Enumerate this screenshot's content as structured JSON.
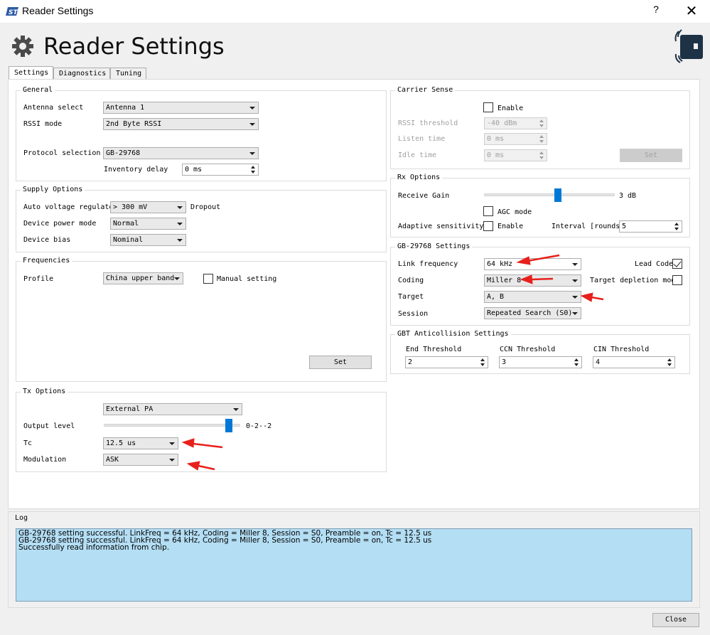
{
  "window": {
    "title": "Reader Settings",
    "help": "?",
    "close": "✕"
  },
  "header": {
    "title": "Reader Settings"
  },
  "tabs": [
    {
      "label": "Settings",
      "active": true
    },
    {
      "label": "Diagnostics",
      "active": false
    },
    {
      "label": "Tuning",
      "active": false
    }
  ],
  "general": {
    "title": "General",
    "antenna_label": "Antenna select",
    "antenna_value": "Antenna 1",
    "rssi_label": "RSSI mode",
    "rssi_value": "2nd Byte RSSI",
    "protocol_label": "Protocol selection",
    "protocol_value": "GB-29768",
    "inventory_delay_label": "Inventory delay",
    "inventory_delay_value": "0 ms"
  },
  "supply": {
    "title": "Supply Options",
    "avr_label": "Auto voltage regulator",
    "avr_value": "> 300 mV",
    "avr_suffix": "Dropout",
    "power_mode_label": "Device power mode",
    "power_mode_value": "Normal",
    "bias_label": "Device bias",
    "bias_value": "Nominal"
  },
  "frequencies": {
    "title": "Frequencies",
    "profile_label": "Profile",
    "profile_value": "China upper band",
    "manual_label": "Manual setting",
    "manual_checked": false,
    "set_label": "Set"
  },
  "tx": {
    "title": "Tx Options",
    "pa_value": "External PA",
    "output_label": "Output level",
    "output_value": "0-2--2",
    "output_fraction": 0.94,
    "tc_label": "Tc",
    "tc_value": "12.5 us",
    "modulation_label": "Modulation",
    "modulation_value": "ASK"
  },
  "carrier": {
    "title": "Carrier Sense",
    "enable_label": "Enable",
    "enable_checked": false,
    "rssi_threshold_label": "RSSI threshold",
    "rssi_threshold_value": "-40 dBm",
    "listen_label": "Listen time",
    "listen_value": "0 ms",
    "idle_label": "Idle time",
    "idle_value": "0 ms",
    "set_label": "Set"
  },
  "rx": {
    "title": "Rx Options",
    "gain_label": "Receive Gain",
    "gain_value": "3 dB",
    "gain_fraction": 0.57,
    "agc_label": "AGC mode",
    "agc_checked": false,
    "adaptive_label": "Adaptive sensitivity",
    "adaptive_enable_label": "Enable",
    "adaptive_checked": false,
    "interval_label": "Interval [rounds]",
    "interval_value": "5"
  },
  "gb": {
    "title": "GB-29768 Settings",
    "link_label": "Link frequency",
    "link_value": "64 kHz",
    "lead_label": "Lead Code",
    "lead_checked": true,
    "coding_label": "Coding",
    "coding_value": "Miller 8",
    "depletion_label": "Target depletion mode",
    "depletion_checked": false,
    "target_label": "Target",
    "target_value": "A, B",
    "session_label": "Session",
    "session_value": "Repeated Search (S0)"
  },
  "gbt": {
    "title": "GBT Anticollision Settings",
    "end_label": "End Threshold",
    "end_value": "2",
    "ccn_label": "CCN Threshold",
    "ccn_value": "3",
    "cin_label": "CIN Threshold",
    "cin_value": "4"
  },
  "log": {
    "title": "Log",
    "lines": [
      "GB-29768 setting successful. LinkFreq = 64 kHz, Coding = Miller 8, Session = S0, Preamble = on, Tc = 12.5 us",
      "GB-29768 setting successful. LinkFreq = 64 kHz, Coding = Miller 8, Session = S0, Preamble = on, Tc = 12.5 us",
      "Successfully read information from chip."
    ]
  },
  "footer": {
    "close_label": "Close"
  },
  "colors": {
    "accent": "#0078d7",
    "log_bg": "#b4def4",
    "annotation": "#e8201c"
  }
}
